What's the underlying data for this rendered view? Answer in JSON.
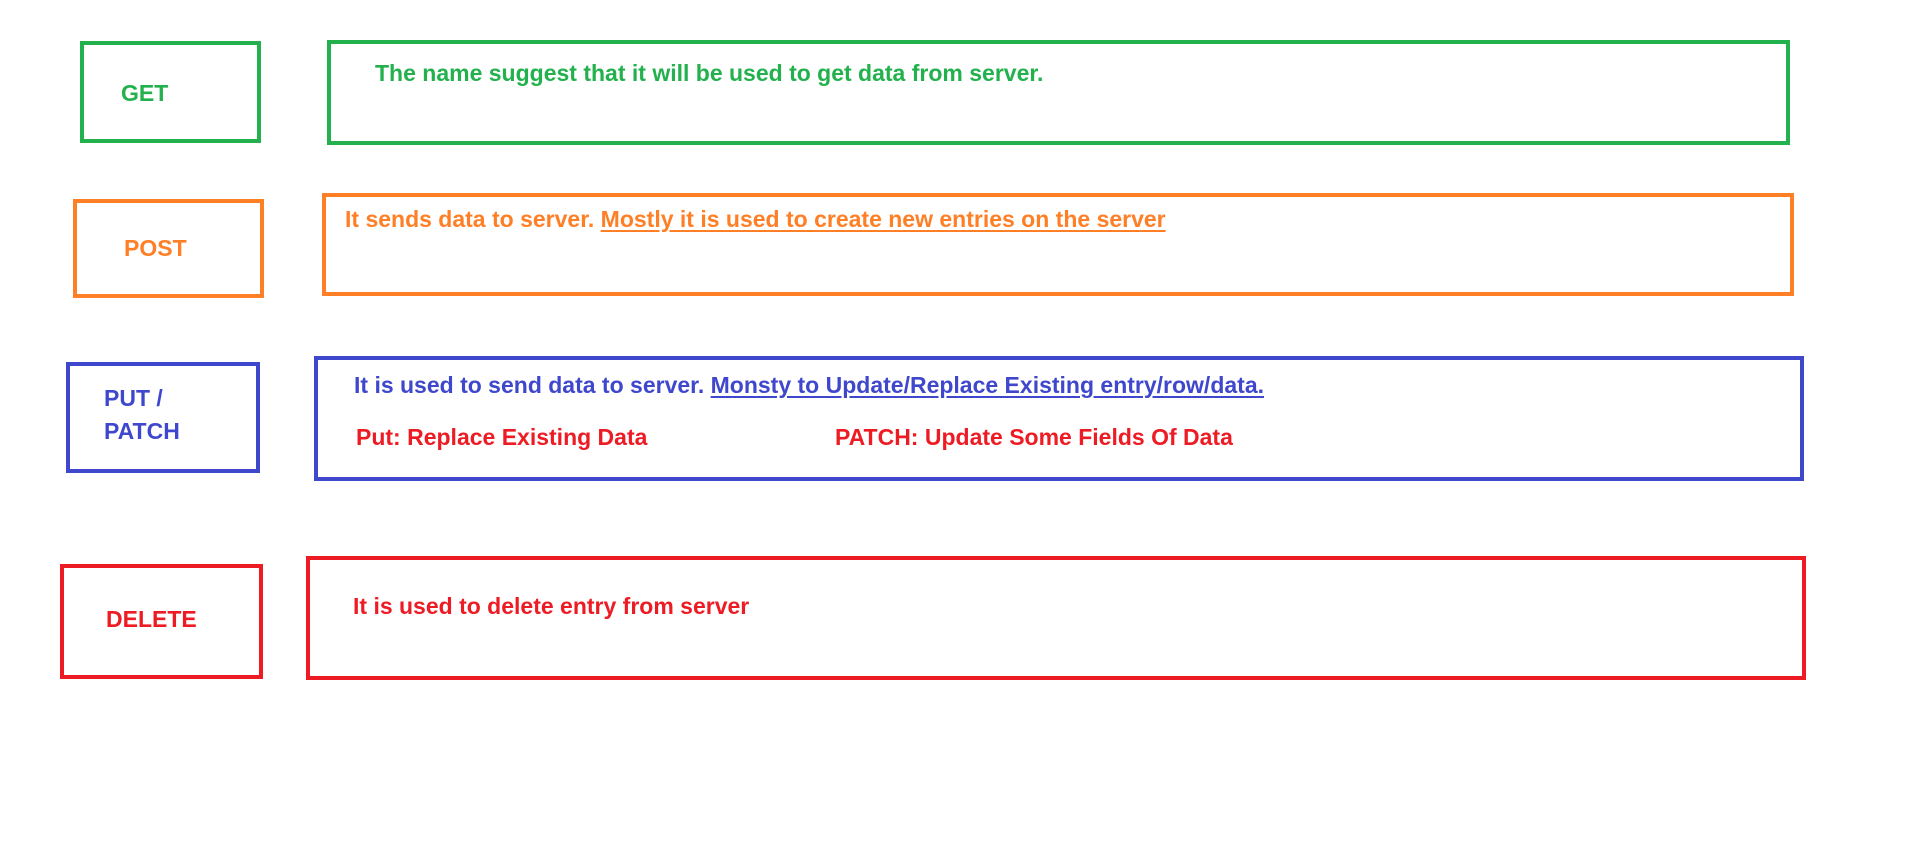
{
  "colors": {
    "get": "#22b14c",
    "post": "#ff7f27",
    "put_patch": "#3f48cc",
    "delete": "#ed1c24"
  },
  "methods": {
    "get": {
      "label": "GET",
      "description": "The name suggest that it will be used to get data from server."
    },
    "post": {
      "label": "POST",
      "description": "It sends data to server.",
      "description_underlined": "Mostly it is used to create new entries on the server"
    },
    "put_patch": {
      "label_line1": "PUT /",
      "label_line2": "PATCH",
      "description": "It is used to send data to server.",
      "description_underlined": "Monsty to Update/Replace Existing entry/row/data.",
      "put_note": "Put: Replace Existing Data",
      "patch_note": "PATCH: Update Some Fields Of Data"
    },
    "delete": {
      "label": "DELETE",
      "description": "It is used to delete entry from server"
    }
  }
}
